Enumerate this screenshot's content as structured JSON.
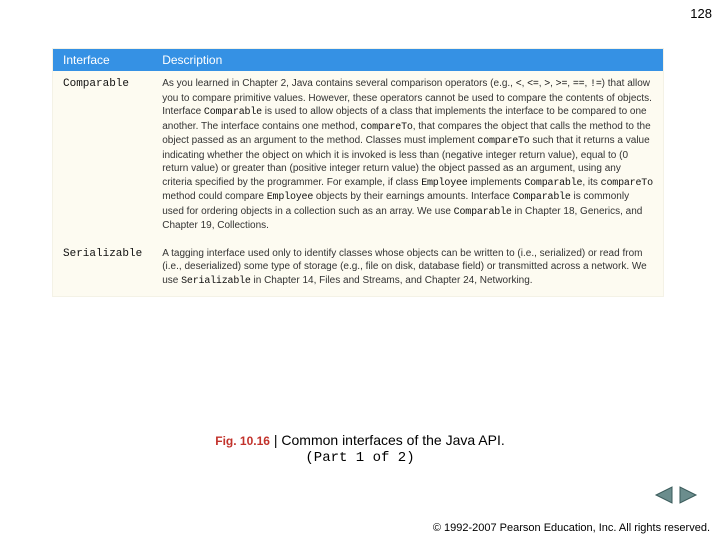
{
  "page_number": "128",
  "table": {
    "headers": {
      "col1": "Interface",
      "col2": "Description"
    },
    "rows": [
      {
        "iface": "Comparable",
        "desc_parts": [
          {
            "t": "As you learned in Chapter 2, Java contains several comparison operators (e.g., "
          },
          {
            "c": "<"
          },
          {
            "t": ", "
          },
          {
            "c": "<="
          },
          {
            "t": ", "
          },
          {
            "c": ">"
          },
          {
            "t": ", "
          },
          {
            "c": ">="
          },
          {
            "t": ", "
          },
          {
            "c": "=="
          },
          {
            "t": ", "
          },
          {
            "c": "!="
          },
          {
            "t": ") that allow you to compare primitive values. However, these operators cannot be used to compare the contents of objects. Interface "
          },
          {
            "c": "Comparable"
          },
          {
            "t": " is used to allow objects of a class that implements the interface to be compared to one another. The interface contains one method, "
          },
          {
            "c": "compareTo"
          },
          {
            "t": ", that compares the object that calls the method to the object passed as an argument to the method. Classes must implement "
          },
          {
            "c": "compareTo"
          },
          {
            "t": " such that it returns a value indicating whether the object on which it is invoked is less than (negative integer return value), equal to (0 return value) or greater than (positive integer return value) the object passed as an argument, using any criteria specified by the programmer. For example, if class "
          },
          {
            "c": "Employee"
          },
          {
            "t": " implements "
          },
          {
            "c": "Comparable"
          },
          {
            "t": ", its "
          },
          {
            "c": "compareTo"
          },
          {
            "t": " method could compare "
          },
          {
            "c": "Employee"
          },
          {
            "t": " objects by their earnings amounts. Interface "
          },
          {
            "c": "Comparable"
          },
          {
            "t": " is commonly used for ordering objects in a collection such as an array. We use "
          },
          {
            "c": "Comparable"
          },
          {
            "t": " in Chapter 18, Generics, and Chapter 19, Collections."
          }
        ]
      },
      {
        "iface": "Serializable",
        "desc_parts": [
          {
            "t": "A tagging interface used only to identify classes whose objects can be written to (i.e., serialized) or read from (i.e., deserialized) some type of storage (e.g., file on disk, database field) or transmitted across a network. We use "
          },
          {
            "c": "Serializable"
          },
          {
            "t": " in Chapter 14, Files and Streams, and Chapter 24, Networking."
          }
        ]
      }
    ]
  },
  "caption": {
    "fignum": "Fig. 10.16",
    "sep": " | ",
    "title": "Common interfaces of the Java API.",
    "part": "(Part 1 of 2)"
  },
  "copyright": "© 1992-2007 Pearson Education, Inc.  All rights reserved."
}
